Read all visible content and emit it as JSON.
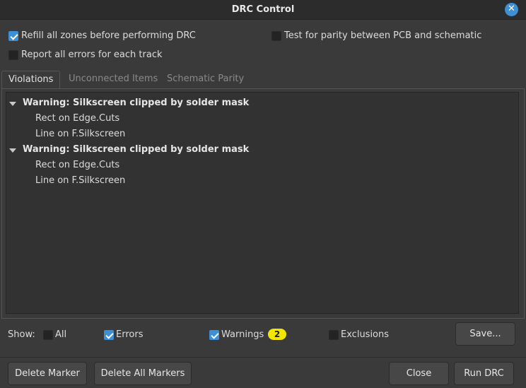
{
  "window": {
    "title": "DRC Control"
  },
  "options": {
    "refill_zones": {
      "label": "Refill all zones before performing DRC",
      "checked": true
    },
    "report_all_errors": {
      "label": "Report all errors for each track",
      "checked": false
    },
    "test_parity": {
      "label": "Test for parity between PCB and schematic",
      "checked": false
    }
  },
  "tabs": [
    {
      "label": "Violations",
      "active": true
    },
    {
      "label": "Unconnected Items",
      "active": false
    },
    {
      "label": "Schematic Parity",
      "active": false
    }
  ],
  "violations": [
    {
      "title": "Warning: Silkscreen clipped by solder mask",
      "items": [
        "Rect on Edge.Cuts",
        "Line on F.Silkscreen"
      ]
    },
    {
      "title": "Warning: Silkscreen clipped by solder mask",
      "items": [
        "Rect on Edge.Cuts",
        "Line on F.Silkscreen"
      ]
    }
  ],
  "filters": {
    "show_label": "Show:",
    "all": {
      "label": "All",
      "checked": false
    },
    "errors": {
      "label": "Errors",
      "checked": true
    },
    "warnings": {
      "label": "Warnings",
      "checked": true,
      "count": "2"
    },
    "exclusions": {
      "label": "Exclusions",
      "checked": false
    }
  },
  "buttons": {
    "save": "Save...",
    "delete_marker": "Delete Marker",
    "delete_all_markers": "Delete All Markers",
    "close": "Close",
    "run_drc": "Run DRC"
  },
  "colors": {
    "accent": "#3d8fd6",
    "badge": "#f2e600",
    "background": "#3a3a3a"
  }
}
